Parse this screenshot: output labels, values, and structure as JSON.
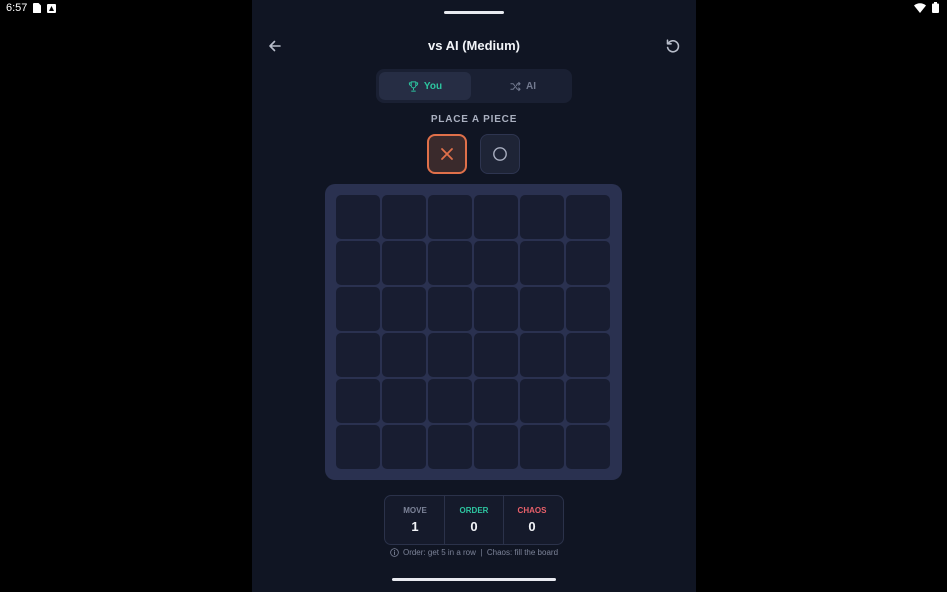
{
  "status_bar": {
    "time": "6:57"
  },
  "header": {
    "title": "vs AI (Medium)",
    "back_icon": "arrow-left-icon",
    "reset_icon": "rotate-ccw-icon"
  },
  "turn_toggle": {
    "you_label": "You",
    "ai_label": "AI",
    "active": "You",
    "you_icon": "trophy-icon",
    "ai_icon": "shuffle-icon"
  },
  "piece_selector": {
    "label": "PLACE A PIECE",
    "selected": "X",
    "options": [
      "X",
      "O"
    ]
  },
  "board": {
    "rows": 6,
    "cols": 6,
    "cells": [
      [
        "",
        "",
        "",
        "",
        "",
        ""
      ],
      [
        "",
        "",
        "",
        "",
        "",
        ""
      ],
      [
        "",
        "",
        "",
        "",
        "",
        ""
      ],
      [
        "",
        "",
        "",
        "",
        "",
        ""
      ],
      [
        "",
        "",
        "",
        "",
        "",
        ""
      ],
      [
        "",
        "",
        "",
        "",
        "",
        ""
      ]
    ]
  },
  "stats": {
    "move_label": "MOVE",
    "move_value": "1",
    "order_label": "ORDER",
    "order_value": "0",
    "chaos_label": "CHAOS",
    "chaos_value": "0"
  },
  "rules": {
    "text": "Order: get 5 in a row  |  Chaos: fill the board"
  },
  "colors": {
    "accent_order": "#2dc5a0",
    "accent_chaos": "#e8606a",
    "selected_piece_border": "#e0704a",
    "background": "#101523"
  }
}
